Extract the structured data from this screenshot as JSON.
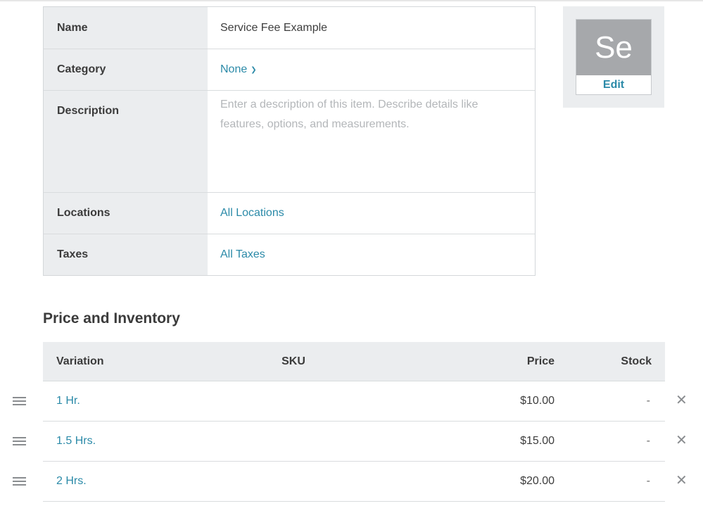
{
  "item": {
    "name_label": "Name",
    "name_value": "Service Fee Example",
    "category_label": "Category",
    "category_value": "None",
    "description_label": "Description",
    "description_placeholder": "Enter a description of this item. Describe details like features, options, and measurements.",
    "locations_label": "Locations",
    "locations_value": "All Locations",
    "taxes_label": "Taxes",
    "taxes_value": "All Taxes"
  },
  "thumbnail": {
    "initials": "Se",
    "edit_label": "Edit",
    "bg_color": "#a6a8ab"
  },
  "inventory": {
    "title": "Price and Inventory",
    "columns": {
      "variation": "Variation",
      "sku": "SKU",
      "price": "Price",
      "stock": "Stock"
    },
    "rows": [
      {
        "variation": "1 Hr.",
        "sku": "",
        "price": "$10.00",
        "stock": "-"
      },
      {
        "variation": "1.5 Hrs.",
        "sku": "",
        "price": "$15.00",
        "stock": "-"
      },
      {
        "variation": "2 Hrs.",
        "sku": "",
        "price": "$20.00",
        "stock": "-"
      }
    ]
  },
  "colors": {
    "link": "#2b8aa8",
    "label_bg": "#ebedef",
    "border": "#d9dcde"
  },
  "icons": {
    "category_dropdown": "chevron-down-icon",
    "row_handle": "drag-handle-icon",
    "row_remove": "close-icon"
  }
}
